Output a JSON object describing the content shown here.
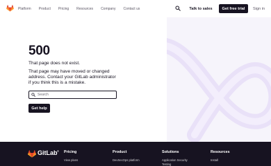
{
  "header": {
    "nav": [
      "Platform",
      "Product",
      "Pricing",
      "Resources",
      "Company",
      "Contact us"
    ],
    "talk_label": "Talk to sales",
    "trial_label": "Get free trial",
    "signin_label": "Sign in",
    "icons": {
      "logo": "gitlab-tanuki-logo",
      "search": "search-icon"
    }
  },
  "error": {
    "code": "500",
    "line1": "That page does not exist.",
    "line2": "That page may have moved or changed address. Contact your GitLab administrator if you think this is a mistake.",
    "search_placeholder": "Search",
    "help_label": "Get help"
  },
  "footer": {
    "brand": "GitLab",
    "reg": "®",
    "columns": [
      {
        "heading": "Pricing",
        "link": "View plans"
      },
      {
        "heading": "Product",
        "link": "DevSecOps platform"
      },
      {
        "heading": "Solutions",
        "link": "Application Security Testing"
      },
      {
        "heading": "Resources",
        "link": "Install"
      }
    ]
  },
  "colors": {
    "text": "#171321",
    "primary_button": "#171321",
    "footer_bg": "#171321",
    "accent_orange": "#fc6d26",
    "accent_red": "#e24329",
    "swirl_purple": "#e6dcf7"
  }
}
